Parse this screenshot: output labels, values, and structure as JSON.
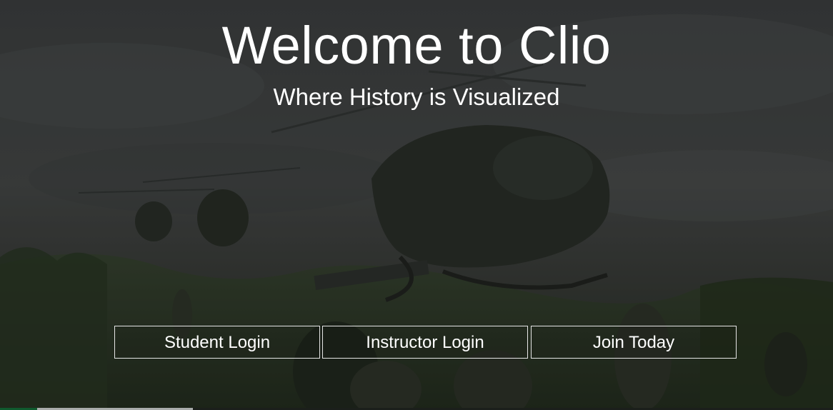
{
  "hero": {
    "title": "Welcome to Clio",
    "subtitle": "Where History is Visualized"
  },
  "buttons": {
    "student_login": "Student Login",
    "instructor_login": "Instructor Login",
    "join_today": "Join Today"
  },
  "colors": {
    "text": "#ffffff",
    "button_border": "#e6e6e6",
    "sky": "#3f4243",
    "foliage": "#2f3a2c"
  }
}
